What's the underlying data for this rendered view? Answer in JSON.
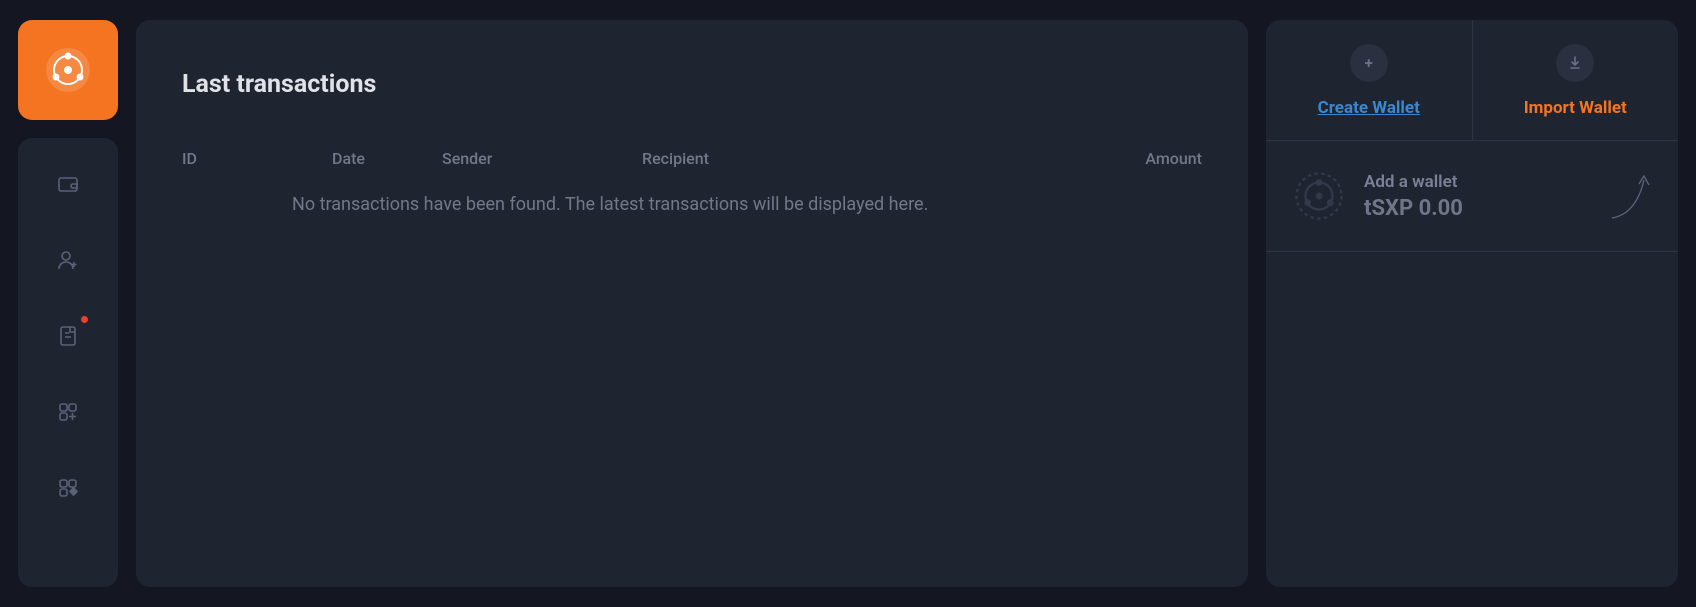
{
  "main": {
    "title": "Last transactions",
    "columns": {
      "id": "ID",
      "date": "Date",
      "sender": "Sender",
      "recipient": "Recipient",
      "amount": "Amount"
    },
    "empty_message": "No transactions have been found. The latest transactions will be displayed here."
  },
  "rightpanel": {
    "tabs": {
      "create": "Create Wallet",
      "import": "Import Wallet"
    },
    "wallet": {
      "add_label": "Add a wallet",
      "balance": "tSXP 0.00"
    }
  },
  "sidebar": {
    "items": [
      "wallet",
      "add-user",
      "document",
      "grid-plus",
      "grid-diamond"
    ]
  }
}
